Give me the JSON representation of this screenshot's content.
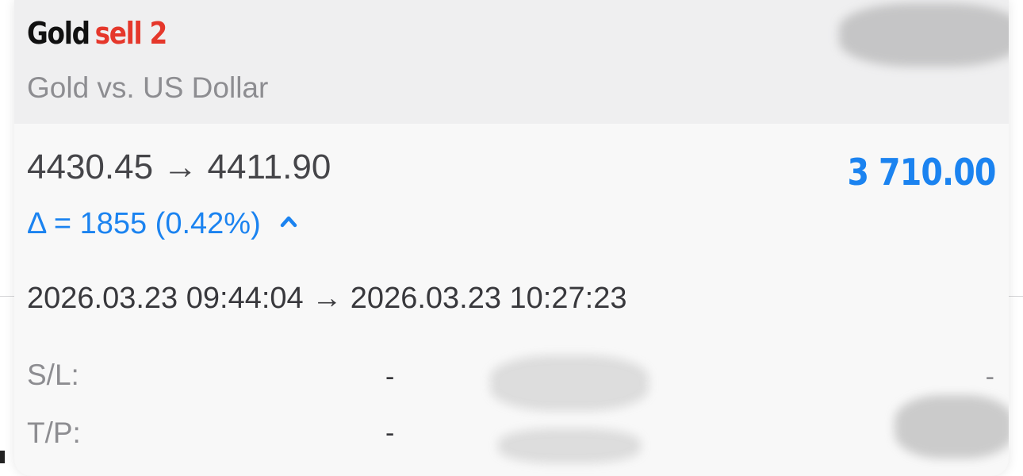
{
  "position": {
    "symbol": "Gold",
    "side": "sell 2",
    "description": "Gold vs. US Dollar",
    "open_price": "4430.45",
    "close_price": "4411.90",
    "arrow": "→",
    "profit": "3 710.00",
    "delta": "Δ = 1855 (0.42%)",
    "open_time": "2026.03.23 09:44:04",
    "close_time": "2026.03.23 10:27:23"
  },
  "fields": {
    "sl_label": "S/L:",
    "sl_value": "-",
    "tp_label": "T/P:",
    "tp_value": "-",
    "right_value": "-"
  },
  "colors": {
    "sell": "#e5372b",
    "accent": "#1b83f0"
  },
  "icons": {
    "delta_indicator": "chevron-up-icon"
  }
}
